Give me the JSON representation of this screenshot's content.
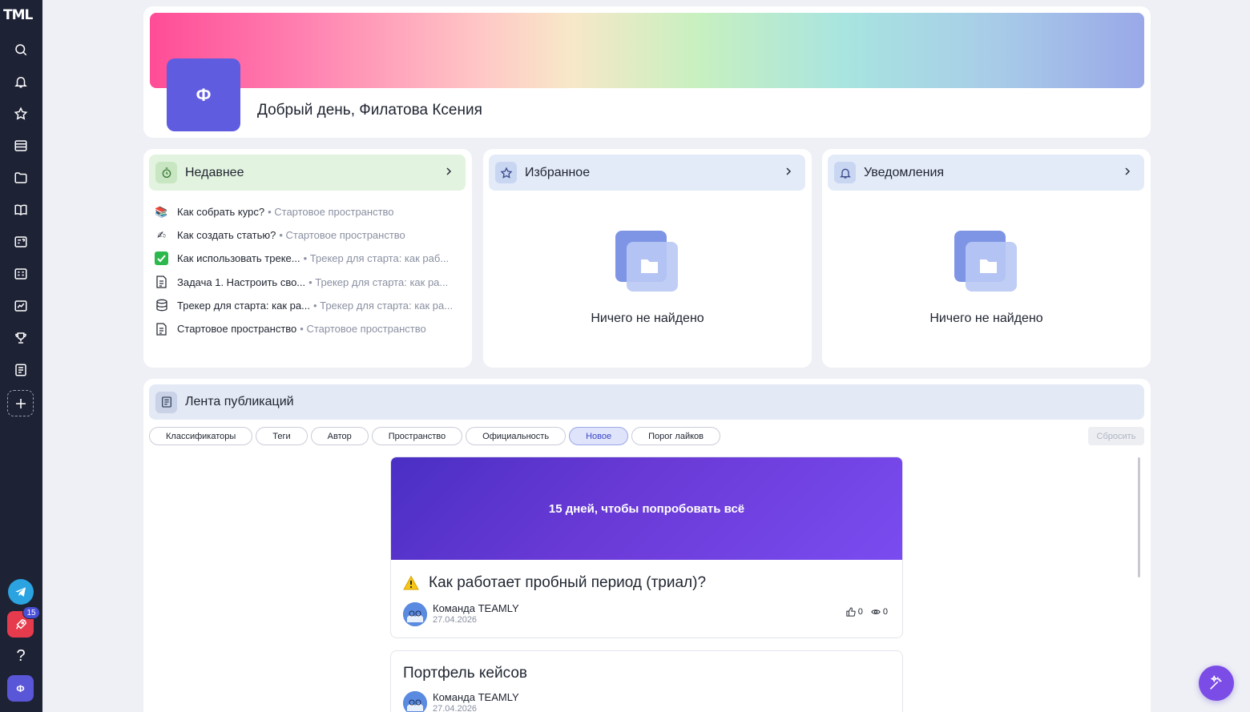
{
  "sidebar": {
    "logo": "TML",
    "icons": [
      "search-icon",
      "bell-icon",
      "star-icon",
      "layers-icon",
      "folder-icon",
      "book-icon",
      "quiz-icon",
      "grid-icon",
      "chart-icon",
      "trophy-icon",
      "list-icon"
    ],
    "rocket_badge": "15",
    "help": "?",
    "user_initial": "Ф"
  },
  "hero": {
    "avatar_initial": "Ф",
    "greeting": "Добрый день, Филатова Ксения"
  },
  "widgets": {
    "recent": {
      "title": "Недавнее",
      "items": [
        {
          "icon": "books-emoji",
          "name": "Как собрать курс?",
          "space": "• Стартовое пространство"
        },
        {
          "icon": "pen-emoji",
          "name": "Как создать статью?",
          "space": "• Стартовое пространство"
        },
        {
          "icon": "check-emoji",
          "name": "Как использовать треке...",
          "space": "• Трекер для старта: как раб..."
        },
        {
          "icon": "document-icon",
          "name": "Задача 1. Настроить сво...",
          "space": "• Трекер для старта: как ра..."
        },
        {
          "icon": "database-icon",
          "name": "Трекер для старта: как ра...",
          "space": "• Трекер для старта: как ра..."
        },
        {
          "icon": "document-icon",
          "name": "Стартовое пространство",
          "space": "• Стартовое пространство"
        }
      ]
    },
    "favorites": {
      "title": "Избранное",
      "empty_text": "Ничего не найдено"
    },
    "notifications": {
      "title": "Уведомления",
      "empty_text": "Ничего не найдено"
    }
  },
  "feed": {
    "title": "Лента публикаций",
    "filters": [
      "Классификаторы",
      "Теги",
      "Автор",
      "Пространство",
      "Официальность",
      "Новое",
      "Порог лайков"
    ],
    "active_filter": "Новое",
    "reset_label": "Сбросить",
    "posts": [
      {
        "banner_text": "15 дней, чтобы попробовать всё",
        "title": "Как работает пробный период (триал)?",
        "author": "Команда TEAMLY",
        "date": "27.04.2026",
        "likes": "0",
        "views": "0"
      },
      {
        "title": "Портфель кейсов",
        "author": "Команда TEAMLY",
        "date": "27.04.2026"
      }
    ]
  },
  "colors": {
    "sidebar_bg": "#1e2235",
    "accent": "#5f5ce0",
    "banner_purple": "#6a3ad6"
  }
}
